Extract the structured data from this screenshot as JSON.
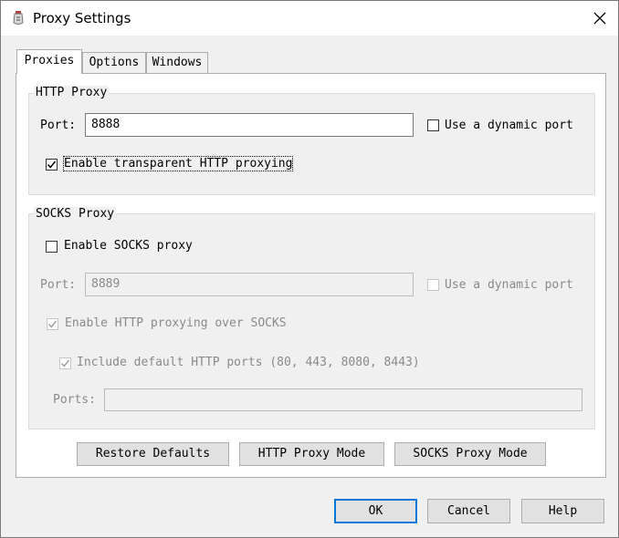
{
  "window": {
    "title": "Proxy Settings",
    "close_glyph": "✕"
  },
  "tabs": [
    {
      "label": "Proxies",
      "active": true
    },
    {
      "label": "Options",
      "active": false
    },
    {
      "label": "Windows",
      "active": false
    }
  ],
  "http_proxy": {
    "legend": "HTTP Proxy",
    "port_label": "Port:",
    "port_value": "8888",
    "dynamic_port_label": "Use a dynamic port",
    "dynamic_port_checked": false,
    "transparent_label": "Enable transparent HTTP proxying",
    "transparent_checked": true
  },
  "socks_proxy": {
    "legend": "SOCKS Proxy",
    "enable_label": "Enable SOCKS proxy",
    "enable_checked": false,
    "port_label": "Port:",
    "port_value": "8889",
    "dynamic_port_label": "Use a dynamic port",
    "dynamic_port_checked": false,
    "http_over_socks_label": "Enable HTTP proxying over SOCKS",
    "http_over_socks_checked": true,
    "default_ports_label": "Include default HTTP ports (80, 443, 8080, 8443)",
    "default_ports_checked": true,
    "ports_label": "Ports:",
    "ports_value": ""
  },
  "panel_buttons": {
    "restore": "Restore Defaults",
    "http_mode": "HTTP Proxy Mode",
    "socks_mode": "SOCKS Proxy Mode"
  },
  "dialog_buttons": {
    "ok": "OK",
    "cancel": "Cancel",
    "help": "Help"
  },
  "colors": {
    "accent": "#0078d7",
    "dialog_bg": "#f0f0f0",
    "disabled_text": "#8a8a8a"
  }
}
